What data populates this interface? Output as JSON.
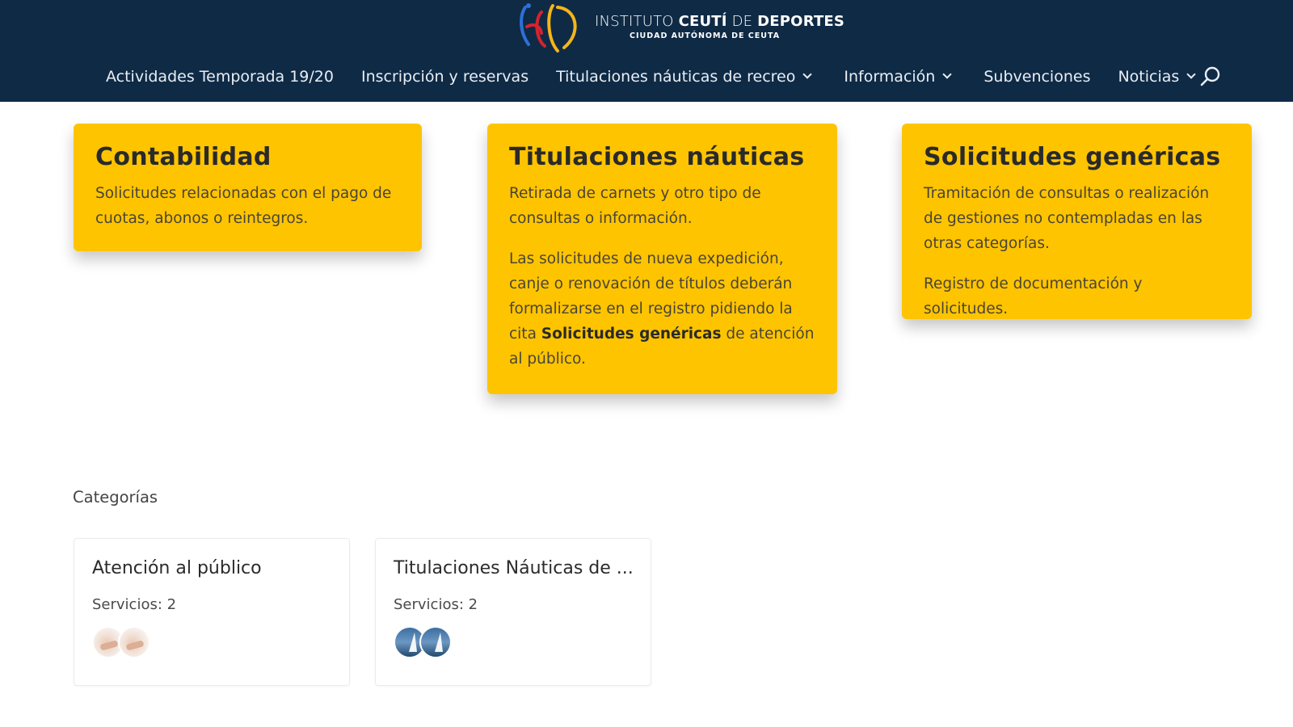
{
  "header": {
    "logo": {
      "line1_regular_a": "INSTITUTO ",
      "line1_bold_a": "CEUTÍ",
      "line1_regular_b": " DE ",
      "line1_bold_b": "DEPORTES",
      "line2": "CIUDAD AUTÓNOMA DE CEUTA"
    },
    "nav": [
      {
        "label": "Actividades Temporada 19/20",
        "has_dropdown": false
      },
      {
        "label": "Inscripción y reservas",
        "has_dropdown": false
      },
      {
        "label": "Titulaciones náuticas de recreo",
        "has_dropdown": true
      },
      {
        "label": "Información",
        "has_dropdown": true
      },
      {
        "label": "Subvenciones",
        "has_dropdown": false
      },
      {
        "label": "Noticias",
        "has_dropdown": true
      }
    ],
    "search_icon": "search-icon"
  },
  "cards": [
    {
      "title": "Contabilidad",
      "paragraphs": [
        "Solicitudes relacionadas con el pago de cuotas, abonos o reintegros."
      ]
    },
    {
      "title": "Titulaciones náuticas",
      "p1": "Retirada de carnets y otro tipo de consultas o información.",
      "p2_before": "Las solicitudes de nueva expedición, canje o renovación de títulos deberán formalizarse en el registro pidiendo la cita ",
      "p2_bold": "Solicitudes genéricas",
      "p2_after": " de atención al público."
    },
    {
      "title": "Solicitudes genéricas",
      "p1": "Tramitación de consultas o realización de gestiones no contempladas en las otras categorías.",
      "p2": "Registro de documentación y solicitudes."
    }
  ],
  "categories": {
    "heading": "Categorías",
    "items": [
      {
        "name": "Atención al público",
        "count": "Servicios: 2"
      },
      {
        "name": "Titulaciones Náuticas de ...",
        "count": "Servicios: 2"
      }
    ]
  },
  "colors": {
    "header_bg": "#0f2a45",
    "card_bg": "#fec400"
  }
}
